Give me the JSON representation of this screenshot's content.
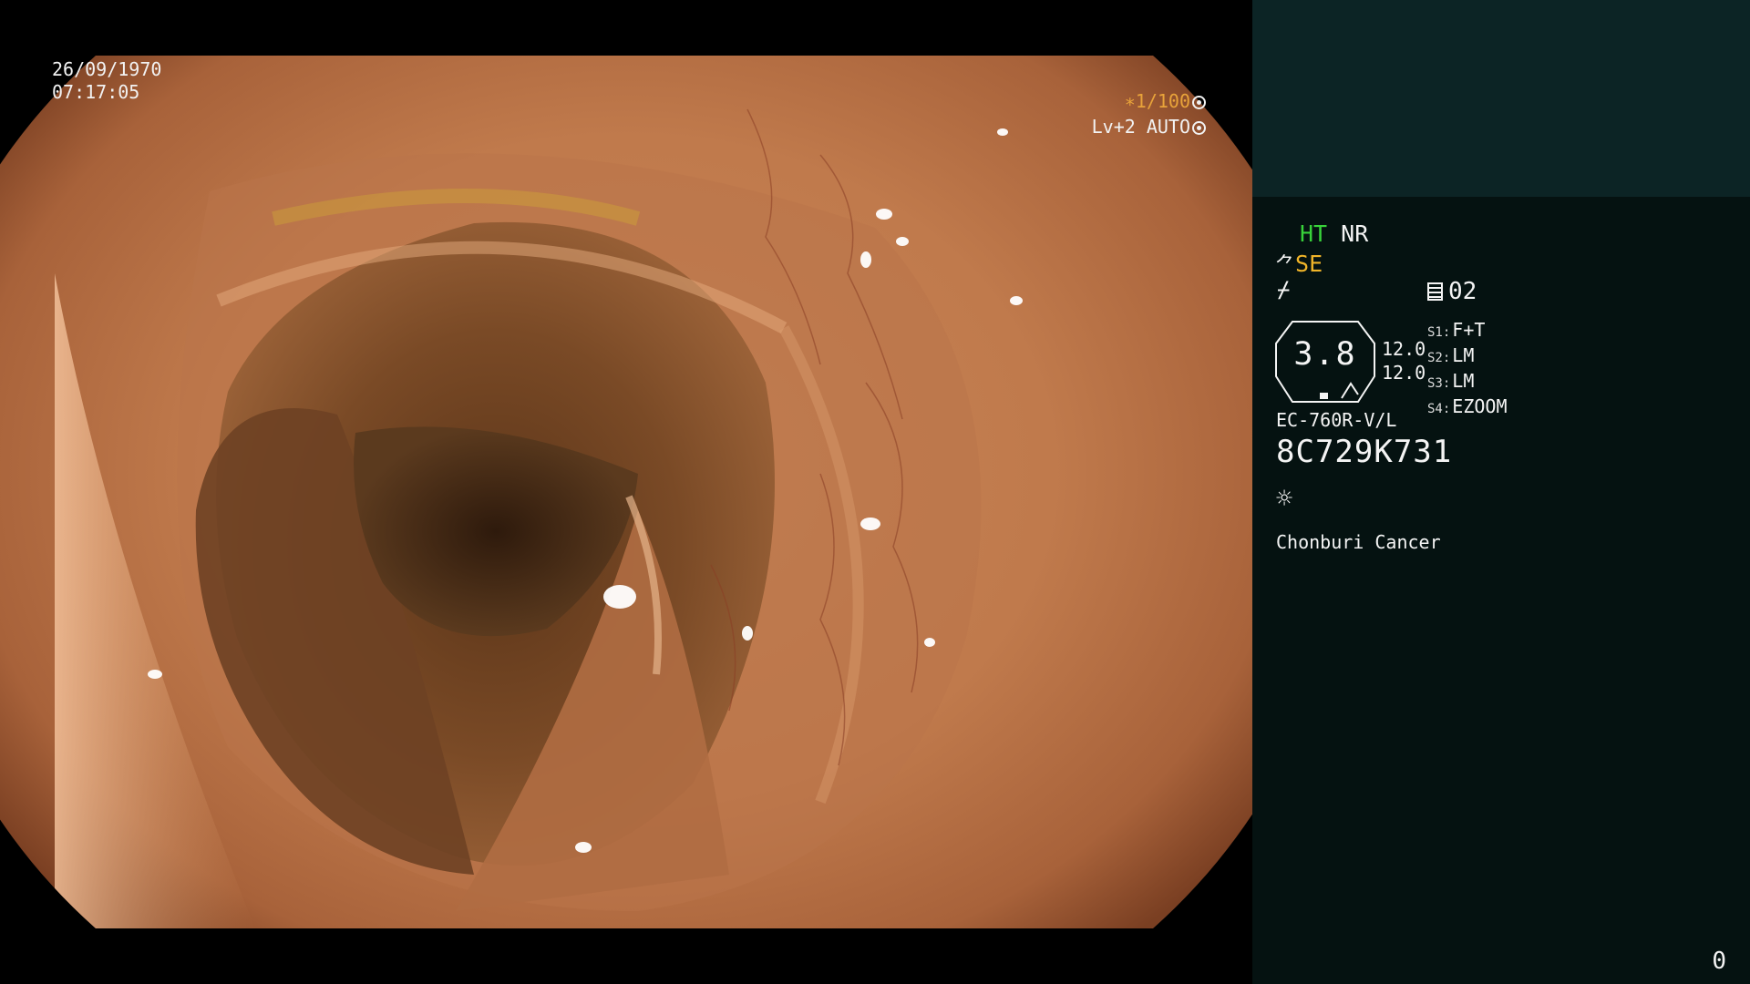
{
  "overlay": {
    "date": "26/09/1970",
    "time": "07:17:05",
    "shutter": "∗1/100",
    "shutter_icon": "aperture-icon",
    "iris": "Lv+2 AUTO",
    "iris_icon": "iris-icon"
  },
  "panel": {
    "ht": "HT",
    "nr": "NR",
    "se": "SE",
    "se_icon": "hand-pump-icon",
    "structure_icon": "structure-enhancement-icon",
    "memo_icon": "memo-icon",
    "memo": "02",
    "center_value": "3.8",
    "value_1": "12.0",
    "value_2": "12.0",
    "settings": [
      {
        "key": "S1:",
        "value": "F+T"
      },
      {
        "key": "S2:",
        "value": "LM"
      },
      {
        "key": "S3:",
        "value": "LM"
      },
      {
        "key": "S4:",
        "value": "EZOOM"
      }
    ],
    "scope_model": "EC-760R-V/L",
    "scope_serial": "8C729K731",
    "light_icon": "light-source-icon",
    "institution": "Chonburi Cancer",
    "counter": "0"
  },
  "colors": {
    "panel_bg": "#051211",
    "panel_header_bg": "#0c2425",
    "ht_green": "#38d23a",
    "se_amber": "#f0b429",
    "shutter_amber": "#e8a33a"
  }
}
